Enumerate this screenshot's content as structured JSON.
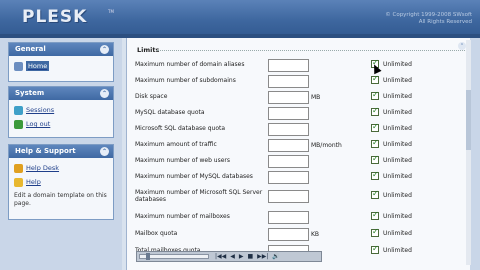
{
  "header": {
    "logo": "PLESK",
    "logo_tm": "TM",
    "copyright_line1": "© Copyright 1999-2008 SWsoft",
    "copyright_line2": "All Rights Reserved"
  },
  "sidebar": {
    "general": {
      "title": "General",
      "items": [
        {
          "label": "Home"
        }
      ]
    },
    "system": {
      "title": "System",
      "items": [
        {
          "label": "Sessions"
        },
        {
          "label": "Log out"
        }
      ]
    },
    "help": {
      "title": "Help & Support",
      "items": [
        {
          "label": "Help Desk"
        },
        {
          "label": "Help"
        }
      ],
      "text": "Edit a domain template on this page."
    }
  },
  "main": {
    "section_title": "Limits",
    "rows": [
      {
        "label": "Maximum number of domain aliases",
        "unit": "",
        "unlimited": "Unlimited"
      },
      {
        "label": "Maximum number of subdomains",
        "unit": "",
        "unlimited": "Unlimited"
      },
      {
        "label": "Disk space",
        "unit": "MB",
        "unlimited": "Unlimited"
      },
      {
        "label": "MySQL database quota",
        "unit": "",
        "unlimited": "Unlimited"
      },
      {
        "label": "Microsoft SQL database quota",
        "unit": "",
        "unlimited": "Unlimited"
      },
      {
        "label": "Maximum amount of traffic",
        "unit": "MB/month",
        "unlimited": "Unlimited"
      },
      {
        "label": "Maximum number of web users",
        "unit": "",
        "unlimited": "Unlimited"
      },
      {
        "label": "Maximum number of MySQL databases",
        "unit": "",
        "unlimited": "Unlimited"
      },
      {
        "label": "Maximum number of Microsoft SQL Server databases",
        "unit": "",
        "unlimited": "Unlimited"
      },
      {
        "label": "Maximum number of mailboxes",
        "unit": "",
        "unlimited": "Unlimited"
      },
      {
        "label": "Mailbox quota",
        "unit": "KB",
        "unlimited": "Unlimited"
      },
      {
        "label": "Total mailboxes quota",
        "unit": "",
        "unlimited": "Unlimited"
      }
    ]
  },
  "media": {
    "buttons": [
      "|◀◀",
      "◀",
      "▶",
      "■",
      "▶▶|",
      "🔊"
    ]
  }
}
